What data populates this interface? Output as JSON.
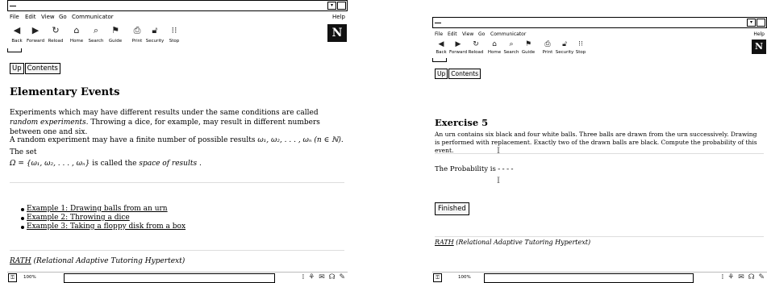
{
  "window_left": {
    "menu": [
      "File",
      "Edit",
      "View",
      "Go",
      "Communicator"
    ],
    "menu_help": "Help",
    "toolbar": [
      {
        "label": "Back",
        "icon": "back-arrow-icon"
      },
      {
        "label": "Forward",
        "icon": "forward-arrow-icon"
      },
      {
        "label": "Reload",
        "icon": "reload-icon"
      },
      {
        "label": "Home",
        "icon": "home-icon"
      },
      {
        "label": "Search",
        "icon": "search-icon"
      },
      {
        "label": "Guide",
        "icon": "guide-icon"
      },
      {
        "label": "Print",
        "icon": "print-icon"
      },
      {
        "label": "Security",
        "icon": "security-lock-icon"
      },
      {
        "label": "Stop",
        "icon": "stop-icon"
      }
    ],
    "logo": "N",
    "nav": {
      "up": "Up",
      "contents": "Contents"
    },
    "title": "Elementary Events",
    "para1_a": "Experiments which may have different results under the same conditions are called ",
    "para1_em": "random experiments",
    "para1_b": ". Throwing a dice, for example, may result in different numbers between one and six.",
    "para2_a": "A random experiment may have a finite number of possible results ",
    "para2_math1": "ω₁, ω₂, . . . , ωₙ (n ∈ ℕ)",
    "para2_b": ". The set",
    "para2_math2": "Ω = {ω₁, ω₂, . . . , ωₙ}",
    "para2_c": " is called the ",
    "para2_em": "space of results",
    "para2_d": " .",
    "links": [
      "Example 1: Drawing balls from an urn",
      "Example 2: Throwing a dice",
      "Example 3: Taking a floppy disk from a box"
    ],
    "footer_rath": "RATH",
    "footer_rest": " (Relational Adaptive Tutoring Hypertext)",
    "status_zoom": "100%"
  },
  "window_right": {
    "menu": [
      "File",
      "Edit",
      "View",
      "Go",
      "Communicator"
    ],
    "menu_help": "Help",
    "toolbar": [
      {
        "label": "Back",
        "icon": "back-arrow-icon"
      },
      {
        "label": "Forward",
        "icon": "forward-arrow-icon"
      },
      {
        "label": "Reload",
        "icon": "reload-icon"
      },
      {
        "label": "Home",
        "icon": "home-icon"
      },
      {
        "label": "Search",
        "icon": "search-icon"
      },
      {
        "label": "Guide",
        "icon": "guide-icon"
      },
      {
        "label": "Print",
        "icon": "print-icon"
      },
      {
        "label": "Security",
        "icon": "security-lock-icon"
      },
      {
        "label": "Stop",
        "icon": "stop-icon"
      }
    ],
    "logo": "N",
    "nav": {
      "up": "Up",
      "contents": "Contents"
    },
    "title": "Exercise 5",
    "para": "An urn contains six black and four white balls. Three balls are drawn from the urn successively. Drawing is performed with replacement. Exactly two of the drawn balls are black. Compute the probability of this event.",
    "prob_label": "The Probability is",
    "prob_value": "----",
    "finished": "Finished",
    "footer_rath": "RATH",
    "footer_rest": " (Relational Adaptive Tutoring Hypertext)",
    "status_zoom": "100%"
  }
}
